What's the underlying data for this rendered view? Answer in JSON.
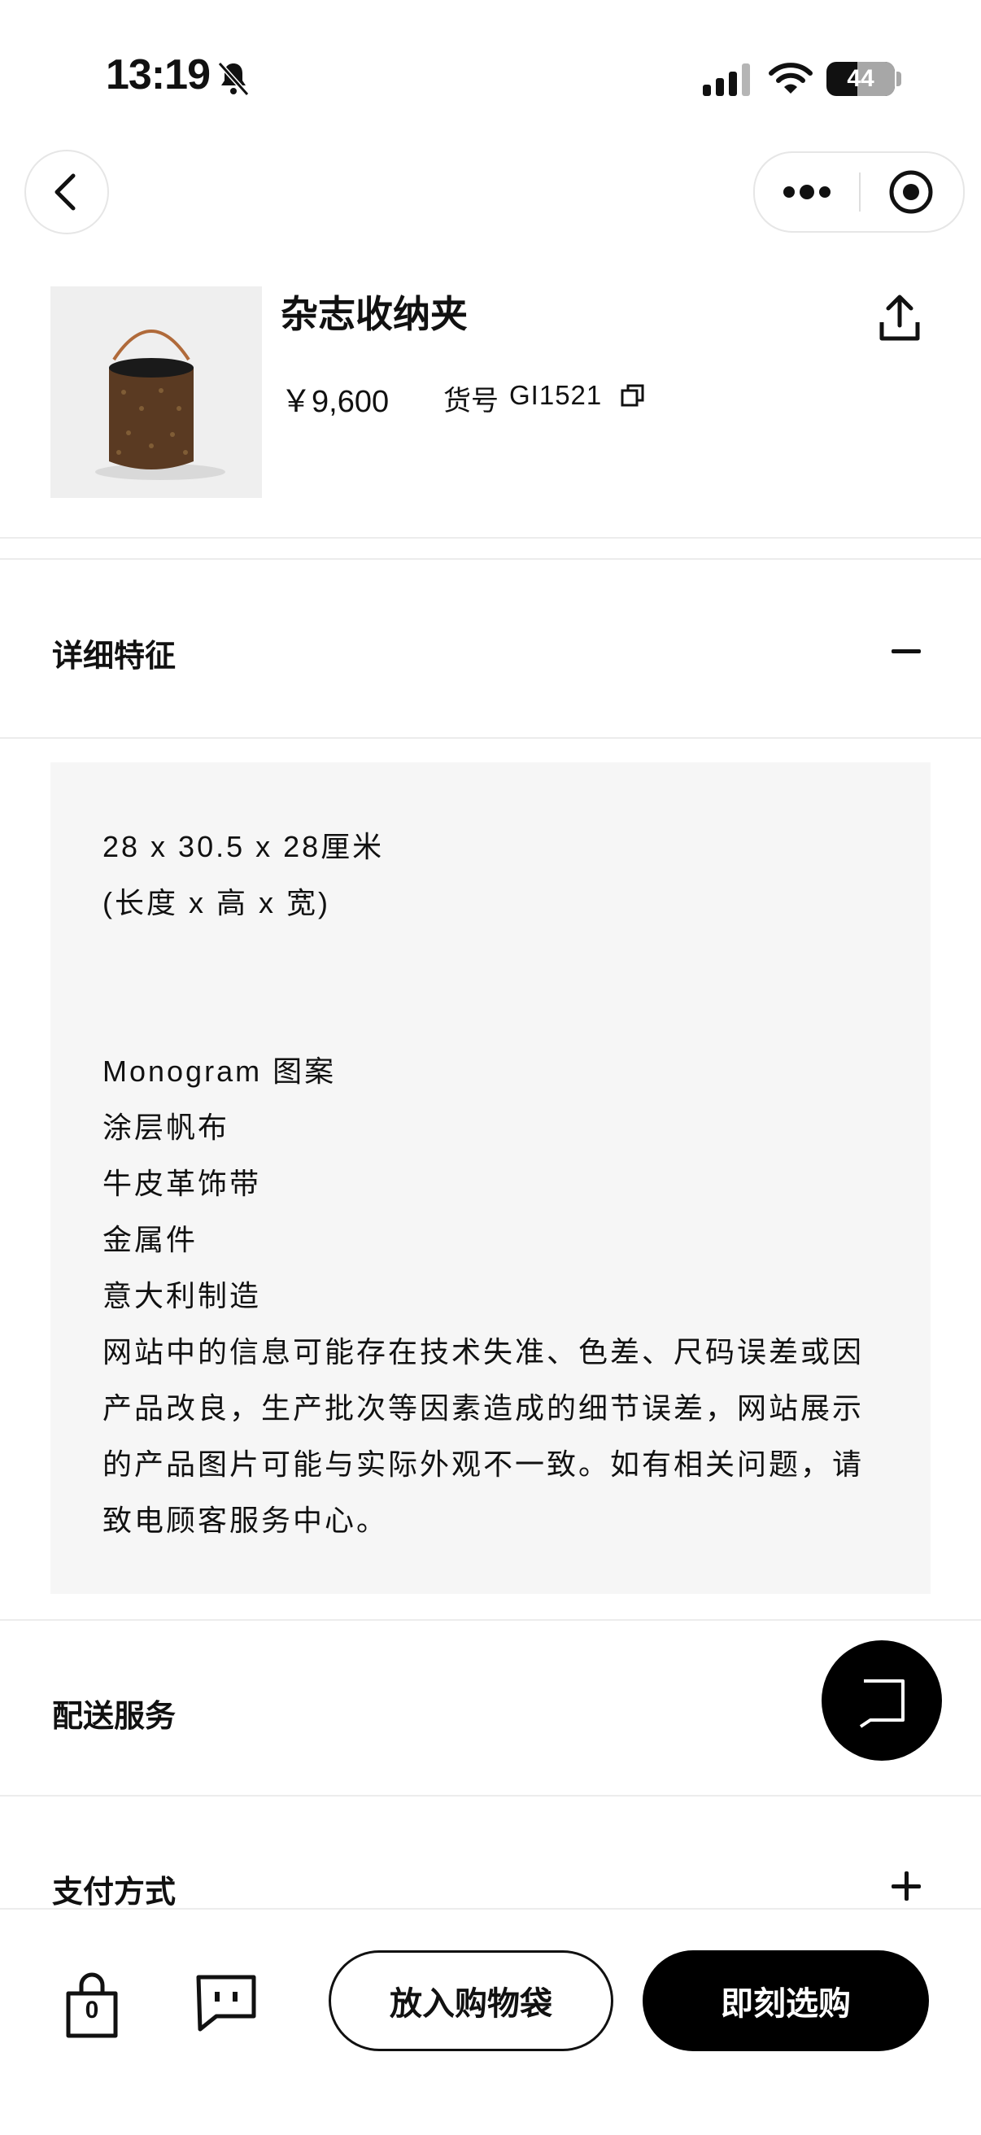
{
  "status_bar": {
    "time": "13:19",
    "battery": "44"
  },
  "nav": {
    "back_icon": "chevron-left-icon",
    "more_icon": "more-dots-icon",
    "close_icon": "target-icon"
  },
  "product": {
    "title": "杂志收纳夹",
    "price": "￥9,600",
    "sku_label": "货号",
    "sku_value": "GI1521",
    "image_icon": "product-bucket-image"
  },
  "sections": {
    "details": {
      "title": "详细特征",
      "lines": [
        "28 x 30.5 x 28厘米",
        "(长度 x 高 x 宽)",
        "Monogram 图案",
        "涂层帆布",
        "牛皮革饰带",
        "金属件",
        "意大利制造",
        "网站中的信息可能存在技术失准、色差、尺码误差或因",
        "产品改良，生产批次等因素造成的细节误差，网站展示",
        "的产品图片可能与实际外观不一致。如有相关问题，请",
        "致电顾客服务中心。"
      ]
    },
    "delivery": {
      "title": "配送服务"
    },
    "payment": {
      "title": "支付方式"
    }
  },
  "bottom_bar": {
    "bag_count": "0",
    "add_to_bag": "放入购物袋",
    "buy_now": "即刻选购"
  },
  "colors": {
    "accent": "#000000",
    "panel": "#f6f6f6",
    "border": "#ececec"
  }
}
